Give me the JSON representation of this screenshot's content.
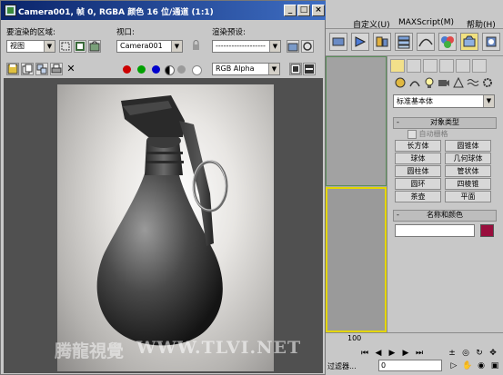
{
  "app": {
    "menus": [
      "自定义(U)",
      "MAXScript(M)",
      "帮助(H)"
    ]
  },
  "render_window": {
    "title": "Camera001, 帧 0, RGBA 颜色 16 位/通道 (1:1)",
    "area_label": "要渲染的区域:",
    "area_value": "视图",
    "viewport_label": "视口:",
    "viewport_value": "Camera001",
    "preset_label": "渲染预设:",
    "preset_value": "-------------------",
    "channel_value": "RGB Alpha"
  },
  "command_panel": {
    "category": "标准基本体",
    "object_type_title": "对象类型",
    "autogrid": "自动栅格",
    "buttons": [
      "长方体",
      "圆锥体",
      "球体",
      "几何球体",
      "圆柱体",
      "管状体",
      "圆环",
      "四棱锥",
      "茶壶",
      "平面"
    ],
    "name_color_title": "名称和颜色",
    "rollout_symbol": "-",
    "swatch_color": "#990e3d"
  },
  "timeline": {
    "frame": "100",
    "frame_field": "0",
    "filter_label": "过滤器..."
  },
  "watermark": {
    "cn": "腾龍視覺",
    "url": "WWW.TLVI.NET"
  },
  "colors": {
    "title_bar": "#0a246a",
    "red_channel": "#cc0000",
    "green_channel": "#00a000",
    "blue_channel": "#0000cc"
  }
}
